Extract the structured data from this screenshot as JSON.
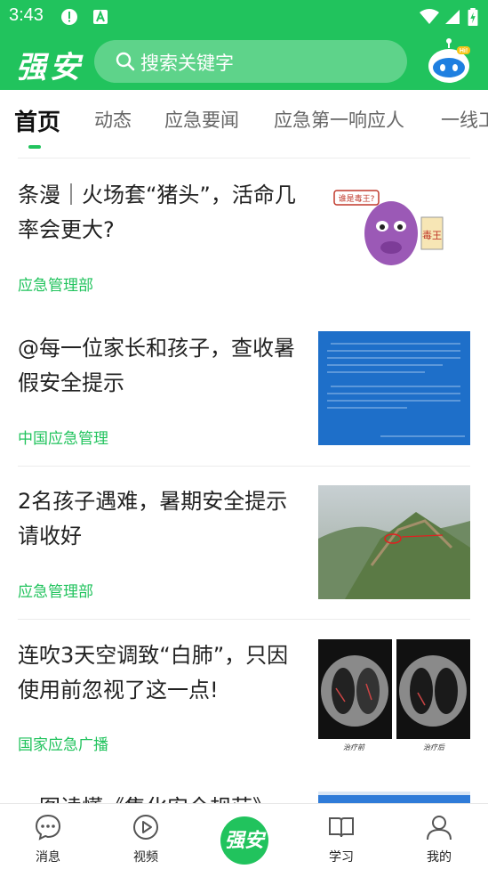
{
  "status_bar": {
    "time": "3:43"
  },
  "header": {
    "logo": "强安",
    "search_placeholder": "搜索关键字",
    "assistant_icon": "robot-icon"
  },
  "tabs": [
    {
      "label": "首页",
      "active": true
    },
    {
      "label": "动态"
    },
    {
      "label": "应急要闻"
    },
    {
      "label": "应急第一响应人"
    },
    {
      "label": "一线工"
    }
  ],
  "feed": [
    {
      "title": "条漫｜火场套“猪头”，活命几率会更大?",
      "source": "应急管理部",
      "thumb_text": "谁是毒王?",
      "thumb_sign": "毒王"
    },
    {
      "title": "@每一位家长和孩子，查收暑假安全提示",
      "source": "中国应急管理"
    },
    {
      "title": "2名孩子遇难，暑期安全提示请收好",
      "source": "应急管理部"
    },
    {
      "title": "连吹3天空调致“白肺”，只因使用前忽视了这一点!",
      "source": "国家应急广播",
      "thumb_captions": [
        "治疗前",
        "治疗后"
      ]
    },
    {
      "title": "一图读懂《集化安全规范》"
    }
  ],
  "bottom_nav": [
    {
      "label": "消息",
      "icon": "message-icon"
    },
    {
      "label": "视频",
      "icon": "play-icon"
    },
    {
      "label": "强安",
      "icon": "home-logo"
    },
    {
      "label": "学习",
      "icon": "book-icon"
    },
    {
      "label": "我的",
      "icon": "person-icon"
    }
  ],
  "colors": {
    "brand": "#21c35d"
  }
}
